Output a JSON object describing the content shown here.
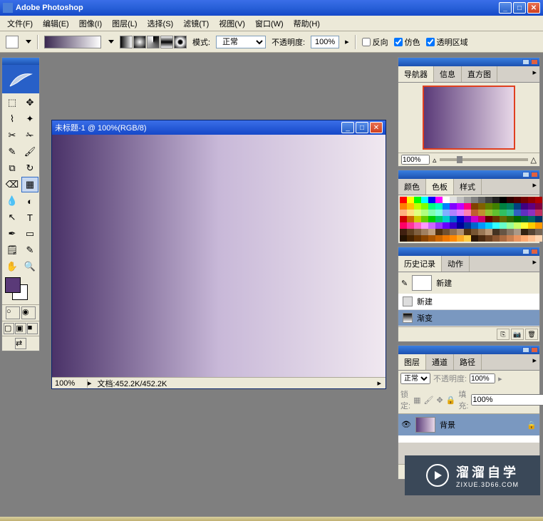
{
  "app": {
    "title": "Adobe Photoshop"
  },
  "menu": {
    "file": "文件(F)",
    "edit": "编辑(E)",
    "image": "图像(I)",
    "layer": "图层(L)",
    "select": "选择(S)",
    "filter": "滤镜(T)",
    "view": "视图(V)",
    "window": "窗口(W)",
    "help": "帮助(H)"
  },
  "toolbar": {
    "mode_label": "模式:",
    "mode_value": "正常",
    "opacity_label": "不透明度:",
    "opacity_value": "100%",
    "reverse": "反向",
    "dither": "仿色",
    "transparency": "透明区域"
  },
  "doc": {
    "title": "未标题-1 @ 100%(RGB/8)",
    "zoom": "100%",
    "status": "文档:452.2K/452.2K"
  },
  "nav_panel": {
    "tabs": {
      "navigator": "导航器",
      "info": "信息",
      "histogram": "直方图"
    },
    "zoom": "100%"
  },
  "color_panel": {
    "tabs": {
      "color": "颜色",
      "swatches": "色板",
      "styles": "样式"
    }
  },
  "history_panel": {
    "tabs": {
      "history": "历史记录",
      "actions": "动作"
    },
    "snapshot": "新建",
    "items": [
      "新建",
      "渐变"
    ]
  },
  "layers_panel": {
    "tabs": {
      "layers": "图层",
      "channels": "通道",
      "paths": "路径"
    },
    "blend_mode": "正常",
    "opacity_label": "不透明度:",
    "opacity_value": "100%",
    "lock_label": "锁定:",
    "fill_label": "填充:",
    "fill_value": "100%",
    "layer_name": "背景"
  },
  "watermark": {
    "title": "溜溜自学",
    "url": "ZIXUE.3D66.COM"
  },
  "colors": {
    "swatches_row1": [
      "#ff0000",
      "#ffff00",
      "#00ff00",
      "#00ffff",
      "#0000ff",
      "#ff00ff",
      "#ffffff",
      "#e0e0e0",
      "#c0c0c0",
      "#a0a0a0",
      "#808080",
      "#606060",
      "#404040",
      "#202020",
      "#000000",
      "#300000",
      "#500000",
      "#700000",
      "#900000",
      "#b00000"
    ],
    "swatches_row2": [
      "#ff8000",
      "#ffc000",
      "#c0ff00",
      "#80ff00",
      "#00ff80",
      "#00ffc0",
      "#0080ff",
      "#8000ff",
      "#c000ff",
      "#ff0080",
      "#804000",
      "#806000",
      "#608000",
      "#408000",
      "#008040",
      "#008060",
      "#004080",
      "#400080",
      "#600080",
      "#800040"
    ],
    "swatches_row3": [
      "#ffb080",
      "#ffe080",
      "#e0ff80",
      "#b0ff80",
      "#80ffb0",
      "#80ffe0",
      "#80b0ff",
      "#b080ff",
      "#e080ff",
      "#ff80b0",
      "#c06030",
      "#c09030",
      "#90c030",
      "#60c030",
      "#30c060",
      "#30c090",
      "#3060c0",
      "#6030c0",
      "#9030c0",
      "#c03060"
    ],
    "swatches_row4": [
      "#cc0000",
      "#cc6600",
      "#cccc00",
      "#66cc00",
      "#00cc00",
      "#00cc66",
      "#00cccc",
      "#0066cc",
      "#0000cc",
      "#6600cc",
      "#cc00cc",
      "#cc0066",
      "#660000",
      "#663300",
      "#666600",
      "#336600",
      "#006600",
      "#006633",
      "#006666",
      "#003366"
    ],
    "swatches_row5": [
      "#ff0066",
      "#ff3399",
      "#ff66cc",
      "#ff99ff",
      "#cc66ff",
      "#9933ff",
      "#6600ff",
      "#3300cc",
      "#000099",
      "#003399",
      "#0066cc",
      "#0099ff",
      "#00ccff",
      "#33ffff",
      "#66ffcc",
      "#99ff99",
      "#ccff66",
      "#ffff33",
      "#ffcc00",
      "#ff9900"
    ],
    "swatches_row6": [
      "#402010",
      "#604020",
      "#806040",
      "#a08060",
      "#c0a080",
      "#503010",
      "#705030",
      "#907050",
      "#b09070",
      "#553311",
      "#775533",
      "#997755",
      "#bb9977",
      "#443322",
      "#665544",
      "#887766",
      "#aa9988",
      "#332211",
      "#554433",
      "#776655"
    ],
    "swatches_row7": [
      "#221100",
      "#442200",
      "#663300",
      "#884400",
      "#aa5500",
      "#cc6600",
      "#ee7700",
      "#ff8800",
      "#ffaa22",
      "#ffcc44",
      "#2a1505",
      "#4a2a10",
      "#6a4020",
      "#8a5530",
      "#aa6a40",
      "#ca8050",
      "#ea9560",
      "#ffaa70",
      "#ffc090",
      "#ffd5b0"
    ]
  }
}
